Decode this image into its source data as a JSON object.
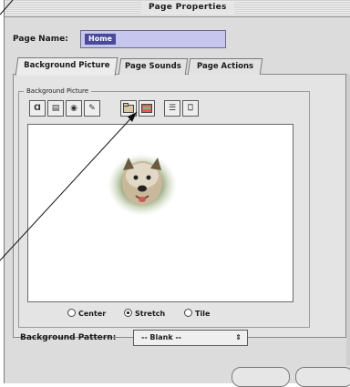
{
  "window": {
    "title": "Page Properties"
  },
  "page_name": {
    "label": "Page Name:",
    "value": "Home"
  },
  "tabs": [
    {
      "label": "Background Picture",
      "active": true
    },
    {
      "label": "Page Sounds",
      "active": false
    },
    {
      "label": "Page Actions",
      "active": false
    }
  ],
  "background_picture": {
    "group_label": "Background Picture",
    "toolbar": [
      {
        "icon": "text-icon",
        "glyph": "Ɑ"
      },
      {
        "icon": "image-icon",
        "glyph": "▤"
      },
      {
        "icon": "clipart-icon",
        "glyph": "◉"
      },
      {
        "icon": "paint-icon",
        "glyph": "✎"
      },
      {
        "icon": "open-image-icon",
        "glyph": "▦"
      },
      {
        "icon": "remove-image-icon",
        "glyph": "▬"
      },
      {
        "icon": "align-icon",
        "glyph": "☰"
      },
      {
        "icon": "properties-icon",
        "glyph": "⎕"
      }
    ],
    "placement_options": [
      {
        "label": "Center",
        "selected": false
      },
      {
        "label": "Stretch",
        "selected": true
      },
      {
        "label": "Tile",
        "selected": false
      }
    ]
  },
  "background_pattern": {
    "label": "Background Pattern:",
    "value": "-- Blank --",
    "arrows": "⇕"
  },
  "colors": {
    "accent": "#4a4a9a",
    "field": "#c6c6ee",
    "dialog": "#dcdcdc"
  }
}
